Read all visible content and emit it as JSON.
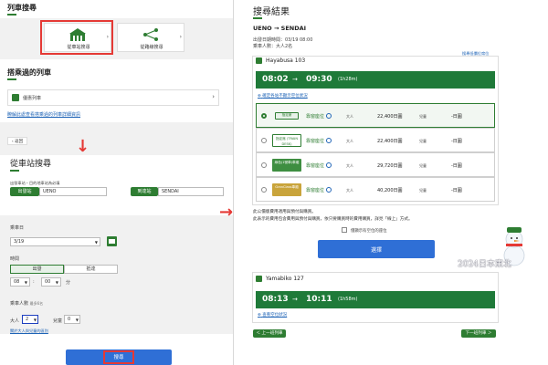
{
  "left": {
    "section1_title": "列車搜尋",
    "search_cards": [
      {
        "label": "從車站搜尋"
      },
      {
        "label": "從路線搜尋"
      }
    ],
    "section2_title": "搭乘過的列車",
    "recent_train": "優惠列車",
    "recent_link": "瞭解此處查看搭乘過的列車詳細資訊",
    "back_label": "返回",
    "station_search_title": "從車站搜尋",
    "station_hint": "出發車站・目的地車站為必填",
    "from_tag": "出發站",
    "from_value": "UENO",
    "to_tag": "到達站",
    "to_value": "SENDAI",
    "date_label": "乘車日",
    "date_value": "3/19",
    "time_label": "時間",
    "time_tabs": [
      "出發",
      "抵達"
    ],
    "hour_value": "08",
    "minute_value": "00",
    "minute_unit": "分",
    "pax_label": "乘車人數",
    "pax_note": "最多6名",
    "adult_label": "大人",
    "adult_value": "2",
    "child_label": "兒童",
    "child_value": "0",
    "pax_link": "關於大人與兒童的區別",
    "search_button": "搜尋"
  },
  "right": {
    "title": "搜尋結果",
    "route_from": "UENO",
    "route_arrow": "→",
    "route_to": "SENDAI",
    "date_line": "出發日期時間：03/19 08:00",
    "pax_line": "乘車人數：大人2名",
    "seat_link": "搜尋低價位席位",
    "train1": {
      "name": "Hayabusa 103",
      "dep": "08:02",
      "arrow": "→",
      "arr": "09:30",
      "duration": "(1h28m)",
      "status_link": "確定各站不顯示空位狀況",
      "rows": [
        {
          "badge": "指定席",
          "seat": "靠窗座位",
          "adult_label": "大人",
          "price": "22,400日圓",
          "child_label": "兒童",
          "child_price": "-日圓"
        },
        {
          "badge": "指定席 (TRAIN DESK)",
          "seat": "靠窗座位",
          "adult_label": "大人",
          "price": "22,400日圓",
          "child_label": "兒童",
          "child_price": "-日圓"
        },
        {
          "badge": "綠色(1號車)車廂",
          "seat": "靠窗座位",
          "adult_label": "大人",
          "price": "29,720日圓",
          "child_label": "兒童",
          "child_price": "-日圓"
        },
        {
          "badge": "GranClass車廂",
          "seat": "靠窗座位",
          "adult_label": "大人",
          "price": "40,200日圓",
          "child_label": "兒童",
          "child_price": "-日圓"
        }
      ]
    },
    "note1": "此公價版費用適用與預付與購買。",
    "note2": "此表示的費用包含費用與預付與購買，依只要購買時的費用購買，詳見「線上」方式。",
    "checkbox_label": "僅顯示有空位的座位",
    "select_button": "選擇",
    "train2": {
      "name": "Yamabiko 127",
      "dep": "08:13",
      "arrow": "→",
      "arr": "10:11",
      "duration": "(1h58m)",
      "status_link": "查看空位狀況"
    },
    "prev_button": "＜ 上一班列車",
    "next_button": "下一班列車 ＞",
    "watermark": "2024日本東北",
    "colors": {
      "brand_green": "#1f7a39",
      "accent_blue": "#2f6fd6",
      "highlight_red": "#e53935"
    }
  }
}
